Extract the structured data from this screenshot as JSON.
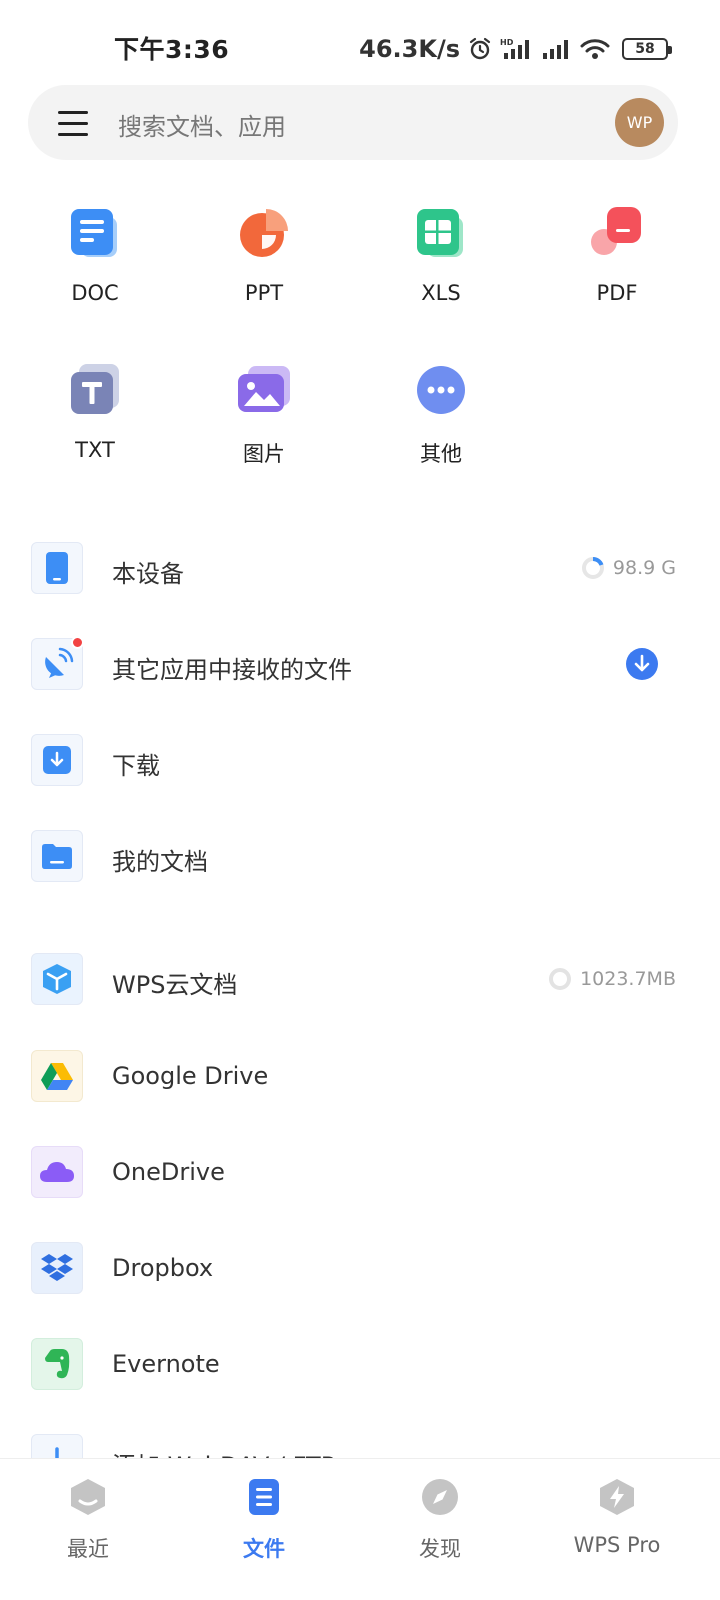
{
  "status_bar": {
    "time": "下午3:36",
    "net_speed": "46.3K/s",
    "battery": "58"
  },
  "search": {
    "placeholder": "搜索文档、应用"
  },
  "avatar": {
    "initials": "WP",
    "color": "#b88a5f"
  },
  "file_types": [
    {
      "label": "DOC",
      "icon": "doc-icon"
    },
    {
      "label": "PPT",
      "icon": "ppt-icon"
    },
    {
      "label": "XLS",
      "icon": "xls-icon"
    },
    {
      "label": "PDF",
      "icon": "pdf-icon"
    },
    {
      "label": "TXT",
      "icon": "txt-icon"
    },
    {
      "label": "图片",
      "icon": "image-icon"
    },
    {
      "label": "其他",
      "icon": "more-icon"
    }
  ],
  "local": [
    {
      "label": "本设备",
      "value": "98.9 G"
    },
    {
      "label": "其它应用中接收的文件"
    },
    {
      "label": "下载"
    },
    {
      "label": "我的文档"
    }
  ],
  "cloud": [
    {
      "label": "WPS云文档",
      "value": "1023.7MB"
    },
    {
      "label": "Google Drive"
    },
    {
      "label": "OneDrive"
    },
    {
      "label": "Dropbox"
    },
    {
      "label": "Evernote"
    },
    {
      "label": "添加 WebDAV / FTP"
    }
  ],
  "bottom_nav": [
    {
      "label": "最近"
    },
    {
      "label": "文件"
    },
    {
      "label": "发现"
    },
    {
      "label": "WPS Pro"
    }
  ],
  "colors": {
    "accent": "#3c7af0",
    "doc": "#3d8ef5",
    "ppt": "#f2683b",
    "xls": "#2ec58b",
    "pdf": "#f4515b"
  }
}
